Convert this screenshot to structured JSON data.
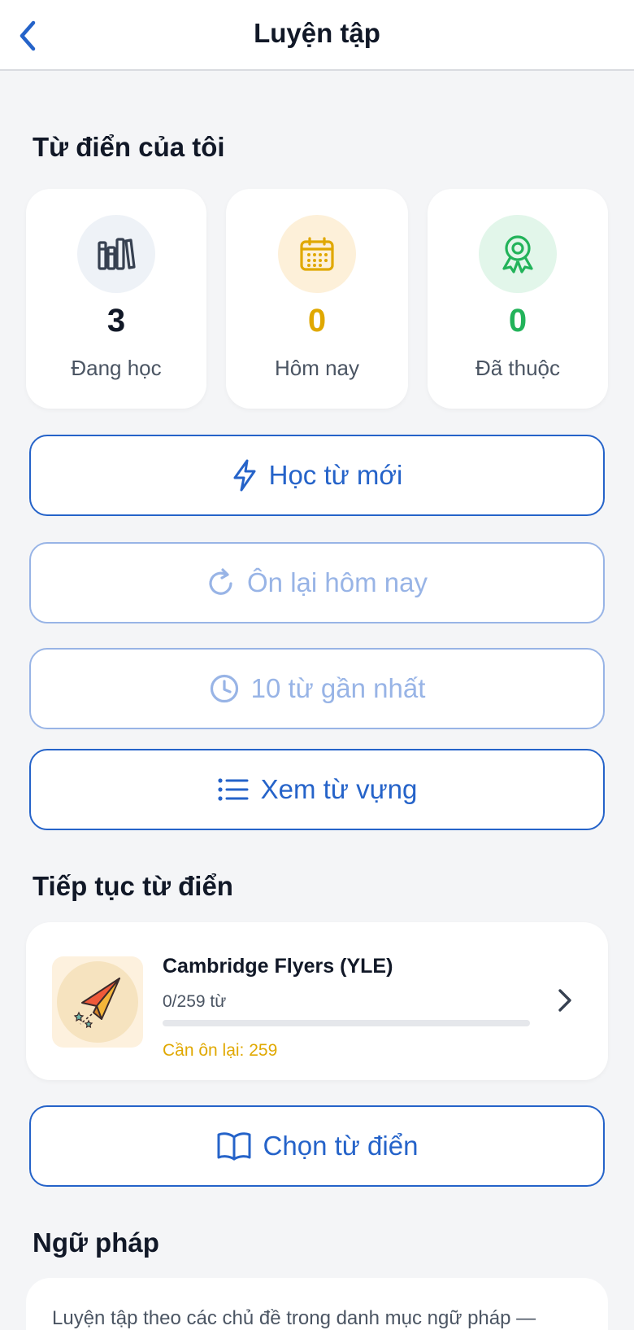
{
  "header": {
    "title": "Luyện tập",
    "back_icon": "chevron-left-icon"
  },
  "my_dictionary": {
    "section_title": "Từ điển của tôi",
    "stats": [
      {
        "value": "3",
        "label": "Đang học",
        "icon": "books-icon",
        "value_color": "#111827",
        "icon_bg": "#eef2f7",
        "icon_color": "#374151"
      },
      {
        "value": "0",
        "label": "Hôm nay",
        "icon": "calendar-icon",
        "value_color": "#e0a800",
        "icon_bg": "#fdf0d9",
        "icon_color": "#e0a800"
      },
      {
        "value": "0",
        "label": "Đã thuộc",
        "icon": "award-icon",
        "value_color": "#22b35a",
        "icon_bg": "#e2f6ea",
        "icon_color": "#22b35a"
      }
    ]
  },
  "actions": {
    "learn_new": {
      "label": "Học từ mới",
      "icon": "lightning-icon",
      "enabled": true
    },
    "review_today": {
      "label": "Ôn lại hôm nay",
      "icon": "refresh-icon",
      "enabled": false
    },
    "recent_words": {
      "label": "10 từ gần nhất",
      "icon": "clock-icon",
      "enabled": false
    },
    "view_vocab": {
      "label": "Xem từ vựng",
      "icon": "list-icon",
      "enabled": true
    }
  },
  "continue_dictionary": {
    "section_title": "Tiếp tục từ điển",
    "item": {
      "name": "Cambridge Flyers (YLE)",
      "count": "0/259 từ",
      "progress": 0,
      "review": "Cần ôn lại: 259",
      "icon": "paper-plane-icon"
    },
    "choose_button": {
      "label": "Chọn từ điển",
      "icon": "open-book-icon"
    }
  },
  "grammar": {
    "section_title": "Ngữ pháp",
    "description": "Luyện tập theo các chủ đề trong danh mục ngữ pháp —"
  },
  "colors": {
    "accent": "#2563c9",
    "accent_disabled": "#98b4e6",
    "warning": "#e0a800",
    "success": "#22b35a"
  }
}
